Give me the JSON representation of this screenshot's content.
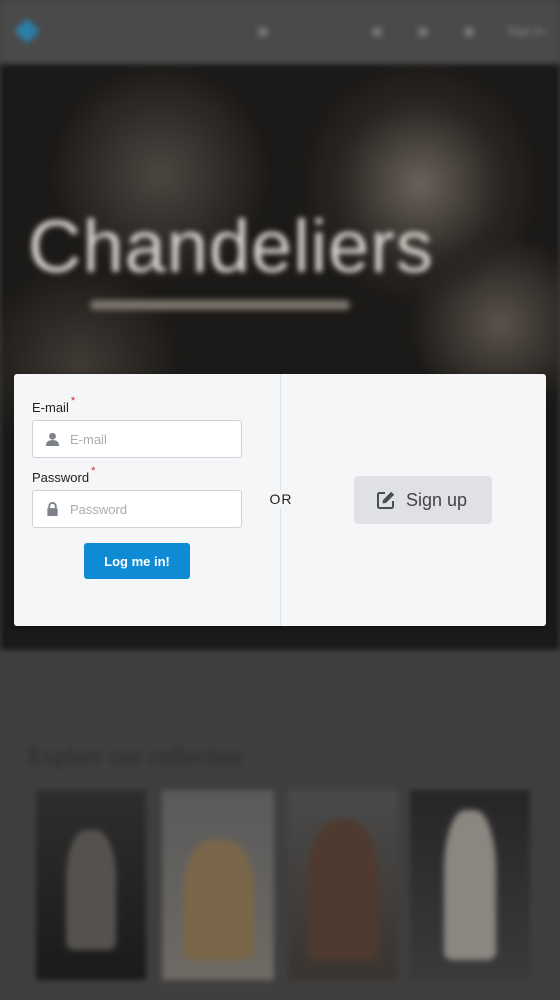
{
  "background": {
    "hero_title": "Chandeliers",
    "section_title": "Explore our collection",
    "topbar_text": "Sign in"
  },
  "login": {
    "email_label": "E-mail",
    "email_placeholder": "E-mail",
    "email_value": "",
    "password_label": "Password",
    "password_placeholder": "Password",
    "password_value": "",
    "required_marker": "*",
    "submit_label": "Log me in!"
  },
  "divider_label": "OR",
  "signup": {
    "label": "Sign up",
    "icon": "edit-icon"
  },
  "colors": {
    "primary": "#0f8bd6",
    "required": "#d9232d",
    "secondary_button": "#dfe1e4"
  }
}
